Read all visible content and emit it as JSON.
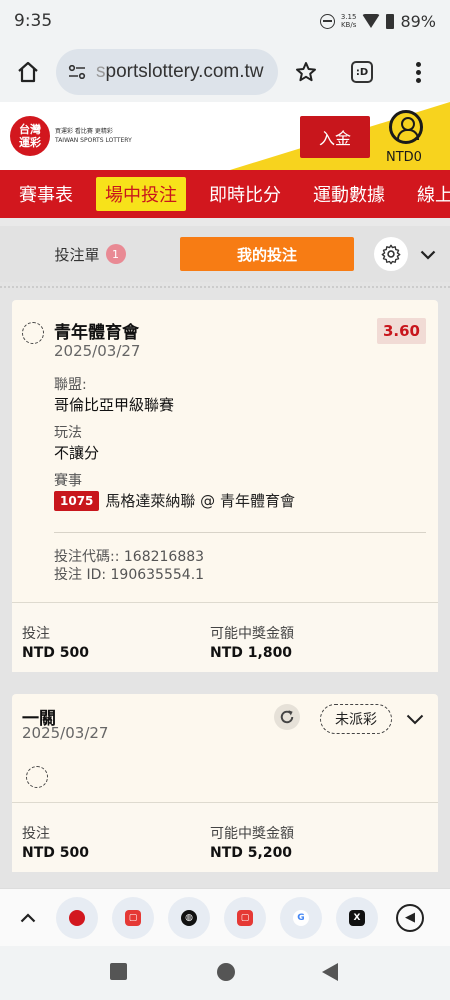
{
  "status_bar": {
    "time": "9:35",
    "speed_value": "3.15",
    "speed_unit": "KB/s",
    "battery": "89%"
  },
  "browser": {
    "url_prefix": "s",
    "url_rest": "portslottery.com.tw",
    "tab_label": ":D"
  },
  "site_header": {
    "logo_line1": "台灣",
    "logo_line2": "運彩",
    "tagline": "買運彩 看比賽 更精彩",
    "brand_en": "TAIWAN SPORTS LOTTERY",
    "deposit_label": "入金",
    "balance": "NTD0",
    "accent_color": "#d2171e",
    "yellow_color": "#f7d31e"
  },
  "nav": {
    "items": [
      {
        "label": "賽事表"
      },
      {
        "label": "場中投注"
      },
      {
        "label": "即時比分"
      },
      {
        "label": "運動數據"
      },
      {
        "label": "線上"
      }
    ],
    "active": "場中投注"
  },
  "betslip": {
    "tab_label": "投注單",
    "count": "1",
    "my_bets_label": "我的投注"
  },
  "bets": [
    {
      "title": "青年體育會",
      "date": "2025/03/27",
      "odds": "3.60",
      "league_label": "聯盟:",
      "league_value": "哥倫比亞甲級聯賽",
      "market_label": "玩法",
      "market_value": "不讓分",
      "event_label": "賽事",
      "event_code": "1075",
      "event_name": "馬格達萊納聯 @ 青年體育會",
      "bet_code": "投注代碼:: 168216883",
      "bet_id": "投注 ID: 190635554.1",
      "stake_label": "投注",
      "stake_value": "NTD 500",
      "payout_label": "可能中獎金額",
      "payout_value": "NTD 1,800"
    },
    {
      "title": "一關",
      "date": "2025/03/27",
      "status": "未派彩",
      "stake_label": "投注",
      "stake_value": "NTD 500",
      "payout_label": "可能中獎金額",
      "payout_value": "NTD 5,200"
    }
  ],
  "bottom_tabs": [
    "tab-lottery-icon",
    "tab-youtube-icon",
    "tab-globe-icon",
    "tab-youtube-icon",
    "tab-google-icon",
    "tab-x-icon"
  ]
}
